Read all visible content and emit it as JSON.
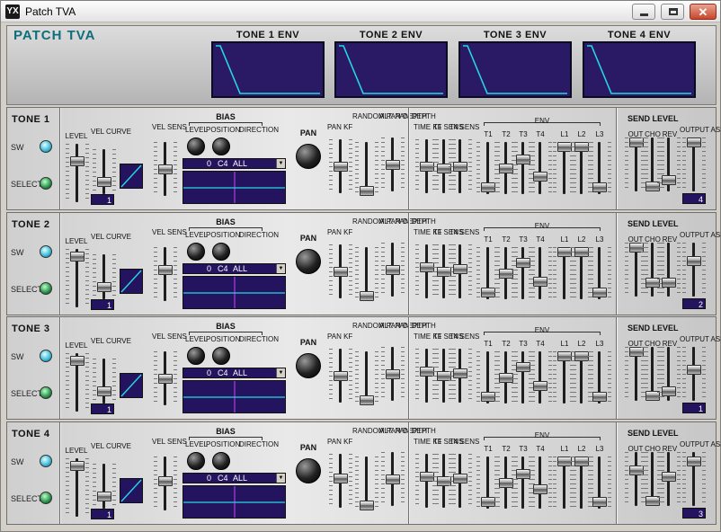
{
  "window": {
    "title": "Patch TVA",
    "app_icon": "YX"
  },
  "header": {
    "title": "PATCH TVA",
    "env_titles": [
      "TONE 1 ENV",
      "TONE 2 ENV",
      "TONE 3 ENV",
      "TONE 4 ENV"
    ]
  },
  "labels": {
    "sw": "SW",
    "select": "SELECT",
    "level": "LEVEL",
    "vel_curve": "VEL CURVE",
    "vel_sens": "VEL SENS",
    "bias": "BIAS",
    "bias_level": "LEVEL",
    "bias_position": "POSITION",
    "bias_direction": "DIRECTION",
    "pan": "PAN",
    "pan_kf": "PAN KF",
    "random_pan_depth": "RANDOM PAN DEPTH",
    "alt_pan_depth": "ALT. PAN DEPTH",
    "time_kf": "TIME KF",
    "t1_sens": "T1 SENS",
    "t4_sens": "T4 SENS",
    "env": "ENV",
    "t1": "T1",
    "t2": "T2",
    "t3": "T3",
    "t4": "T4",
    "l1": "L1",
    "l2": "L2",
    "l3": "L3",
    "send_level": "SEND LEVEL",
    "out": "OUT",
    "cho": "CHO",
    "rev": "REV",
    "output_assign": "OUTPUT ASSIGN"
  },
  "tones": [
    {
      "name": "TONE 1",
      "vel_curve": "1",
      "bias_level": "0",
      "bias_position": "C4",
      "bias_direction": "ALL",
      "output_assign": "4",
      "levels": {
        "level": 0.75,
        "vel_curve": 0.2,
        "vel_sens": 0.5,
        "pan_kf": 0.5,
        "random_pan": 0.0,
        "alt_pan": 0.5,
        "time_kf": 0.5,
        "t1_sens": 0.45,
        "t4_sens": 0.5,
        "t1": 0.05,
        "t2": 0.5,
        "t3": 0.7,
        "t4": 0.3,
        "l1": 1.0,
        "l2": 1.0,
        "l3": 0.05,
        "out": 1.0,
        "cho": 0.0,
        "rev": 0.15,
        "assign_f": 1.0
      }
    },
    {
      "name": "TONE 2",
      "vel_curve": "1",
      "bias_level": "0",
      "bias_position": "C4",
      "bias_direction": "ALL",
      "output_assign": "2",
      "levels": {
        "level": 0.95,
        "vel_curve": 0.2,
        "vel_sens": 0.6,
        "pan_kf": 0.5,
        "random_pan": 0.0,
        "alt_pan": 0.5,
        "time_kf": 0.6,
        "t1_sens": 0.5,
        "t4_sens": 0.55,
        "t1": 0.05,
        "t2": 0.5,
        "t3": 0.75,
        "t4": 0.3,
        "l1": 1.0,
        "l2": 1.0,
        "l3": 0.05,
        "out": 1.0,
        "cho": 0.2,
        "rev": 0.2,
        "assign_f": 0.7
      }
    },
    {
      "name": "TONE 3",
      "vel_curve": "1",
      "bias_level": "0",
      "bias_position": "C4",
      "bias_direction": "ALL",
      "output_assign": "1",
      "levels": {
        "level": 0.95,
        "vel_curve": 0.2,
        "vel_sens": 0.5,
        "pan_kf": 0.5,
        "random_pan": 0.0,
        "alt_pan": 0.5,
        "time_kf": 0.6,
        "t1_sens": 0.5,
        "t4_sens": 0.55,
        "t1": 0.05,
        "t2": 0.5,
        "t3": 0.75,
        "t4": 0.3,
        "l1": 1.0,
        "l2": 1.0,
        "l3": 0.05,
        "out": 1.0,
        "cho": 0.0,
        "rev": 0.1,
        "assign_f": 0.6
      }
    },
    {
      "name": "TONE 4",
      "vel_curve": "1",
      "bias_level": "0",
      "bias_position": "C4",
      "bias_direction": "ALL",
      "output_assign": "3",
      "levels": {
        "level": 0.95,
        "vel_curve": 0.2,
        "vel_sens": 0.55,
        "pan_kf": 0.55,
        "random_pan": 0.0,
        "alt_pan": 0.5,
        "time_kf": 0.6,
        "t1_sens": 0.5,
        "t4_sens": 0.55,
        "t1": 0.05,
        "t2": 0.5,
        "t3": 0.7,
        "t4": 0.35,
        "l1": 1.0,
        "l2": 1.0,
        "l3": 0.05,
        "out": 0.7,
        "cho": 0.0,
        "rev": 0.55,
        "assign_f": 0.9
      }
    }
  ],
  "colors": {
    "accent": "#0f6e7a",
    "display": "#241460",
    "led_sw": "#39b8d8",
    "led_select": "#28904a"
  }
}
